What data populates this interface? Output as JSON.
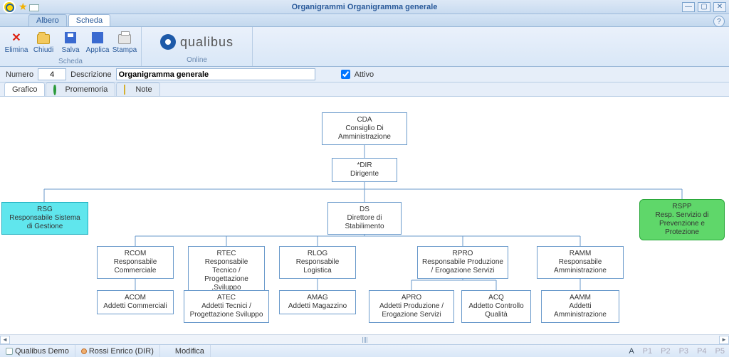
{
  "window": {
    "title": "Organigrammi Organigramma generale"
  },
  "uppertabs": {
    "albero": "Albero",
    "scheda": "Scheda"
  },
  "ribbon": {
    "elimina": "Elimina",
    "chiudi": "Chiudi",
    "salva": "Salva",
    "applica": "Applica",
    "stampa": "Stampa",
    "group_scheda": "Scheda",
    "group_online": "Online",
    "brand": "qualibus"
  },
  "form": {
    "numero_label": "Numero",
    "numero_value": "4",
    "descrizione_label": "Descrizione",
    "descrizione_value": "Organigramma generale",
    "attivo_label": "Attivo"
  },
  "lowertabs": {
    "grafico": "Grafico",
    "promemoria": "Promemoria",
    "note": "Note"
  },
  "nodes": {
    "cda": {
      "code": "CDA",
      "desc": "Consiglio Di Amministrazione"
    },
    "dir": {
      "code": "*DIR",
      "desc": "Dirigente"
    },
    "rsg": {
      "code": "RSG",
      "desc": "Responsabile Sistema di Gestione"
    },
    "ds": {
      "code": "DS",
      "desc": "Direttore di Stabilimento"
    },
    "rspp": {
      "code": "RSPP",
      "desc": "Resp. Servizio di Prevenzione e Protezione"
    },
    "rcom": {
      "code": "RCOM",
      "desc": "Responsabile Commerciale"
    },
    "rtec": {
      "code": "RTEC",
      "desc": "Responsabile Tecnico / Progettazione ,Sviluppo"
    },
    "rlog": {
      "code": "RLOG",
      "desc": "Responsabile Logistica"
    },
    "rpro": {
      "code": "RPRO",
      "desc": "Responsabile Produzione / Erogazione Servizi"
    },
    "ramm": {
      "code": "RAMM",
      "desc": "Responsabile Amministrazione"
    },
    "acom": {
      "code": "ACOM",
      "desc": "Addetti Commerciali"
    },
    "atec": {
      "code": "ATEC",
      "desc": "Addetti Tecnici / Progettazione Sviluppo"
    },
    "amag": {
      "code": "AMAG",
      "desc": "Addetti Magazzino"
    },
    "apro": {
      "code": "APRO",
      "desc": "Addetti Produzione / Erogazione Servizi"
    },
    "acq": {
      "code": "ACQ",
      "desc": "Addetto Controllo Qualità"
    },
    "aamm": {
      "code": "AAMM",
      "desc": "Addetti Amministrazione"
    }
  },
  "status": {
    "demo": "Qualibus Demo",
    "user": "Rossi Enrico (DIR)",
    "mode": "Modifica",
    "a": "A",
    "p1": "P1",
    "p2": "P2",
    "p3": "P3",
    "p4": "P4",
    "p5": "P5"
  }
}
